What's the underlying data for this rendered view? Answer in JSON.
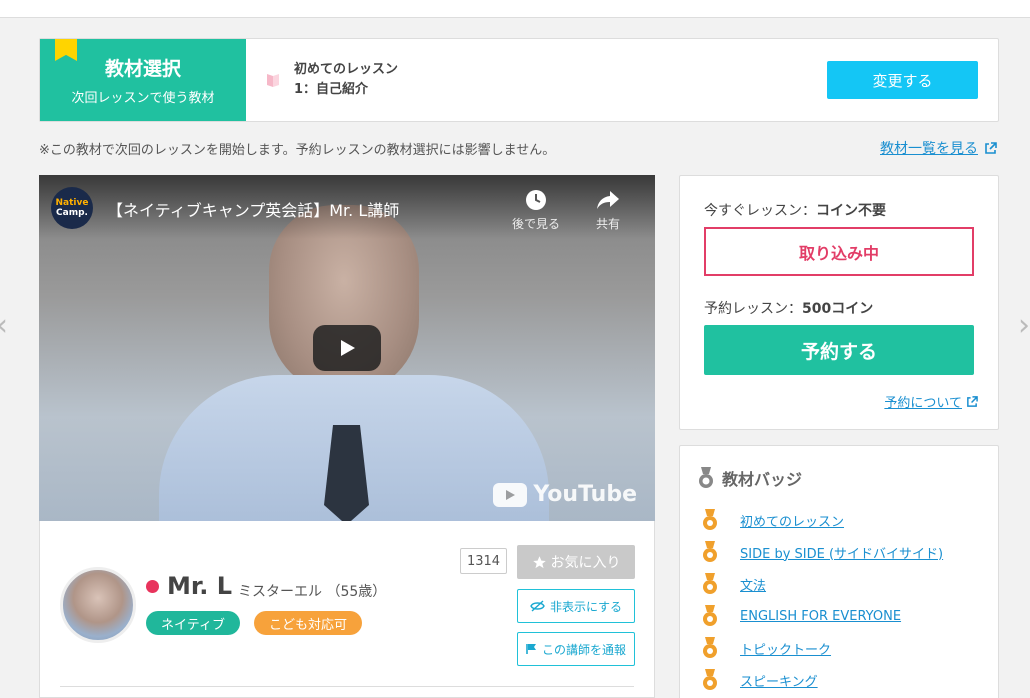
{
  "material": {
    "label_title": "教材選択",
    "label_sub": "次回レッスンで使う教材",
    "name_line1": "初めてのレッスン",
    "name_line2": "1：自己紹介",
    "change_button": "変更する"
  },
  "notice": "※この教材で次回のレッスンを開始します。予約レッスンの教材選択には影響しません。",
  "list_link": "教材一覧を見る",
  "video": {
    "channel_logo_top": "Native",
    "channel_logo_bottom": "Camp.",
    "title": "【ネイティブキャンプ英会話】Mr. L講師",
    "watch_later": "後で見る",
    "share": "共有",
    "youtube_label": "YouTube"
  },
  "teacher": {
    "name": "Mr. L",
    "kana_age": "ミスターエル （55歳）",
    "tags": [
      "ネイティブ",
      "こども対応可"
    ],
    "favorite_count": "1314",
    "favorite_button": "お気に入り",
    "hide_button": "非表示にする",
    "report_button": "この講師を通報"
  },
  "booking": {
    "now_label": "今すぐレッスン：",
    "now_value": "コイン不要",
    "status": "取り込み中",
    "reserve_label": "予約レッスン：",
    "reserve_value": "500コイン",
    "reserve_button": "予約する",
    "about_link": "予約について"
  },
  "badges": {
    "title": "教材バッジ",
    "items": [
      "初めてのレッスン",
      "SIDE by SIDE (サイドバイサイド)",
      "文法",
      "ENGLISH FOR EVERYONE",
      "トピックトーク",
      "スピーキング"
    ]
  },
  "colors": {
    "accent_green": "#20c1a0",
    "accent_blue": "#14c6f5",
    "status_red": "#e23d67",
    "badge_orange": "#f0a02c"
  },
  "icons": {
    "ribbon": "bookmark-ribbon-icon",
    "book": "book-icon",
    "external": "external-link-icon",
    "clock": "clock-icon",
    "share": "share-icon",
    "play": "play-icon",
    "star": "star-icon",
    "eye_off": "eye-off-icon",
    "flag": "flag-icon",
    "medal": "medal-icon",
    "chevron_left": "chevron-left-icon",
    "chevron_right": "chevron-right-icon"
  }
}
